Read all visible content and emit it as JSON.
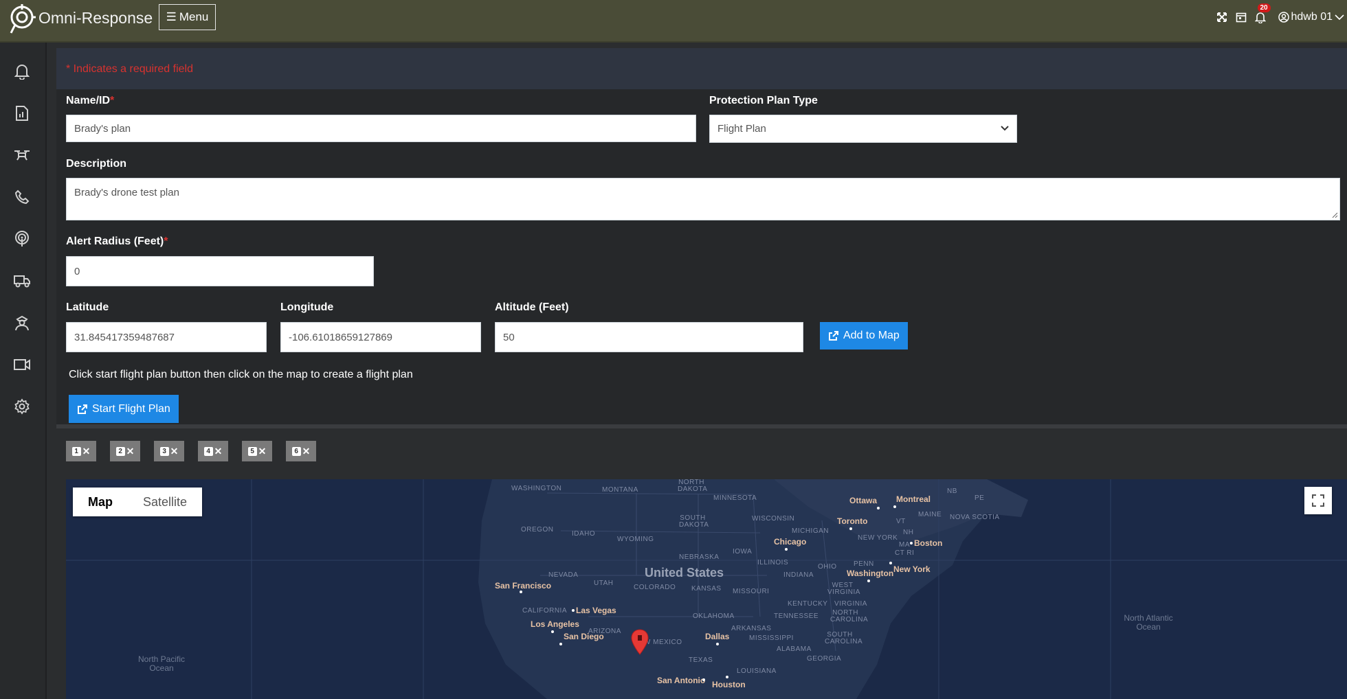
{
  "header": {
    "app_title": "Omni-Response",
    "menu_label": "Menu",
    "notification_count": "20",
    "user_name": "hdwb 01"
  },
  "sidebar": {
    "items": [
      {
        "name": "alerts",
        "icon": "bell-icon"
      },
      {
        "name": "reports",
        "icon": "report-icon"
      },
      {
        "name": "drones",
        "icon": "drone-icon"
      },
      {
        "name": "calls",
        "icon": "phone-icon"
      },
      {
        "name": "sensors",
        "icon": "radar-icon"
      },
      {
        "name": "vehicles",
        "icon": "truck-icon"
      },
      {
        "name": "responders",
        "icon": "officer-icon"
      },
      {
        "name": "cameras",
        "icon": "camera-icon"
      },
      {
        "name": "settings",
        "icon": "gear-icon"
      }
    ]
  },
  "form": {
    "required_note": "* Indicates a required field",
    "name_label": "Name/ID",
    "name_value": "Brady's plan",
    "plan_type_label": "Protection Plan Type",
    "plan_type_value": "Flight Plan",
    "description_label": "Description",
    "description_value": "Brady's drone test plan",
    "alert_radius_label": "Alert Radius (Feet)",
    "alert_radius_value": "0",
    "latitude_label": "Latitude",
    "latitude_value": "31.845417359487687",
    "longitude_label": "Longitude",
    "longitude_value": "-106.61018659127869",
    "altitude_label": "Altitude (Feet)",
    "altitude_value": "50",
    "add_to_map_label": "Add to Map",
    "hint": "Click start flight plan button then click on the map to create a flight plan",
    "start_flight_plan_label": "Start Flight Plan"
  },
  "waypoints": [
    "1",
    "2",
    "3",
    "4",
    "5",
    "6"
  ],
  "map": {
    "toggle_map": "Map",
    "toggle_satellite": "Satellite",
    "country": "United States",
    "ocean_pacific": "North Pacific Ocean",
    "ocean_atlantic": "North Atlantic Ocean",
    "regions": [
      "WASHINGTON",
      "MONTANA",
      "NORTH DAKOTA",
      "MINNESOTA",
      "OREGON",
      "IDAHO",
      "WYOMING",
      "SOUTH DAKOTA",
      "WISCONSIN",
      "MICHIGAN",
      "NEBRASKA",
      "IOWA",
      "ILLINOIS",
      "OHIO",
      "PENN",
      "NEVADA",
      "UTAH",
      "COLORADO",
      "KANSAS",
      "MISSOURI",
      "INDIANA",
      "WEST VIRGINIA",
      "KENTUCKY",
      "VIRGINIA",
      "CALIFORNIA",
      "OKLAHOMA",
      "TENNESSEE",
      "NORTH CAROLINA",
      "ARIZONA",
      "ARKANSAS",
      "SOUTH CAROLINA",
      "MISSISSIPPI",
      "ALABAMA",
      "GEORGIA",
      "TEXAS",
      "LOUISIANA",
      "NEW YORK",
      "VT",
      "NH",
      "MAINE",
      "MA",
      "CT RI",
      "NB",
      "PE",
      "NOVA SCOTIA",
      "NEW MEXICO"
    ],
    "cities": [
      "Ottawa",
      "Montreal",
      "Toronto",
      "Boston",
      "Chicago",
      "New York",
      "Washington",
      "San Francisco",
      "Las Vegas",
      "Los Angeles",
      "San Diego",
      "Dallas",
      "San Antonio",
      "Houston"
    ],
    "accent_pin": "#e53935"
  },
  "colors": {
    "topbar": "#4a4c37",
    "accent": "#1e88e5",
    "required": "#d8322f"
  }
}
